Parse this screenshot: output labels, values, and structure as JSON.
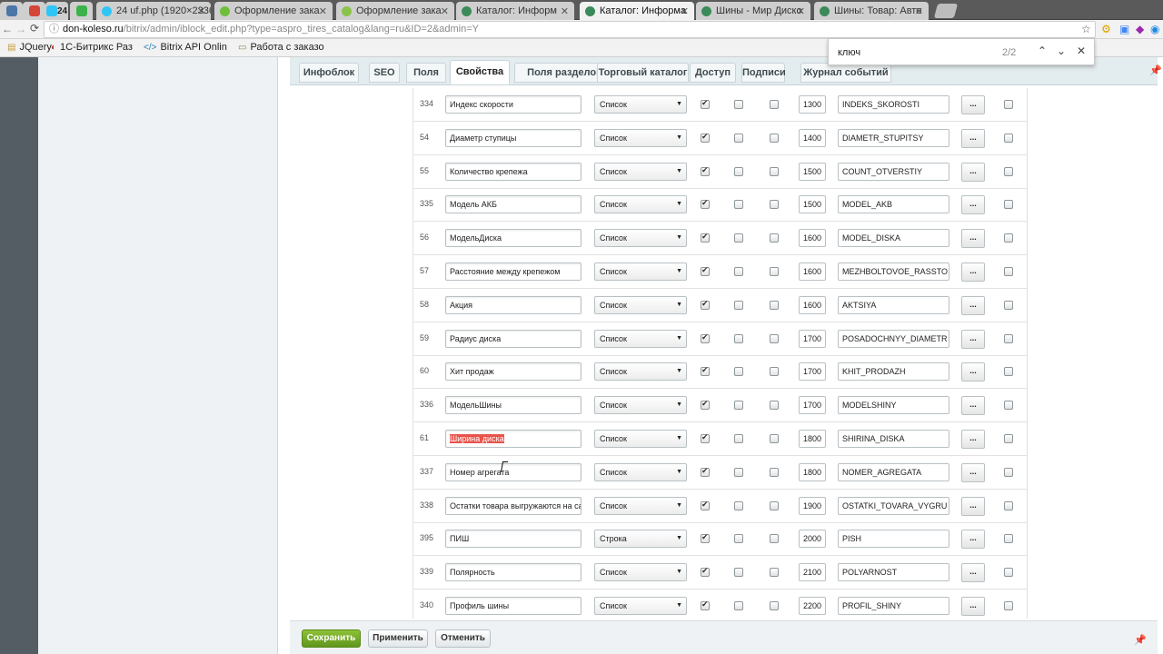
{
  "browser": {
    "tabs": [
      {
        "label": "",
        "fav_color": "#4a76a8"
      },
      {
        "label": "",
        "fav_color": "#d44638"
      },
      {
        "label": "24",
        "fav_color": "#2fc6f6"
      },
      {
        "label": "",
        "fav_color": "#3bb34a"
      },
      {
        "label": "24 uf.php (1920×2336)",
        "fav_color": "#2fc6f6"
      },
      {
        "label": "Оформление зака",
        "fav_color": "#6fbf3a"
      },
      {
        "label": "Оформление зака",
        "fav_color": "#8bc34a"
      },
      {
        "label": "Каталог: Информ",
        "fav_color": "#3b8a5a"
      },
      {
        "label": "Каталог: Информа",
        "fav_color": "#3b8a5a"
      },
      {
        "label": "Шины - Мир Диско",
        "fav_color": "#3b8a5a"
      },
      {
        "label": "Шины: Товар: Авто",
        "fav_color": "#3b8a5a"
      }
    ],
    "url_domain": "don-koleso.ru",
    "url_path": "/bitrix/admin/iblock_edit.php?type=aspro_tires_catalog&lang=ru&ID=2&admin=Y",
    "bookmarks": [
      "JQuery",
      "1С-Битрикс Раз",
      "Bitrix API Onlin",
      "Работа с заказо"
    ],
    "find": {
      "query": "ключ",
      "count": "2/2"
    }
  },
  "editor": {
    "tabs": [
      "Инфоблок",
      "SEO",
      "Поля",
      "Свойства",
      "Поля разделов",
      "Торговый каталог",
      "Доступ",
      "Подписи",
      "Журнал событий"
    ],
    "active_tab": "Свойства",
    "rows": [
      {
        "id": "334",
        "name": "Индекс скорости",
        "type": "Список",
        "sort": "1300",
        "code": "INDEKS_SKOROSTI",
        "more": "..."
      },
      {
        "id": "54",
        "name": "Диаметр ступицы",
        "type": "Список",
        "sort": "1400",
        "code": "DIAMETR_STUPITSY",
        "more": "..."
      },
      {
        "id": "55",
        "name": "Количество крепежа",
        "type": "Список",
        "sort": "1500",
        "code": "COUNT_OTVERSTIY",
        "more": "..."
      },
      {
        "id": "335",
        "name": "Модель АКБ",
        "type": "Список",
        "sort": "1500",
        "code": "MODEL_AKB",
        "more": "..."
      },
      {
        "id": "56",
        "name": "МодельДиска",
        "type": "Список",
        "sort": "1600",
        "code": "MODEL_DISKA",
        "more": "..."
      },
      {
        "id": "57",
        "name": "Расстояние между крепежом",
        "type": "Список",
        "sort": "1600",
        "code": "MEZHBOLTOVOE_RASSTO",
        "more": "..."
      },
      {
        "id": "58",
        "name": "Акция",
        "type": "Список",
        "sort": "1600",
        "code": "AKTSIYA",
        "more": "..."
      },
      {
        "id": "59",
        "name": "Радиус диска",
        "type": "Список",
        "sort": "1700",
        "code": "POSADOCHNYY_DIAMETR",
        "more": "..."
      },
      {
        "id": "60",
        "name": "Хит продаж",
        "type": "Список",
        "sort": "1700",
        "code": "KHIT_PRODAZH",
        "more": "..."
      },
      {
        "id": "336",
        "name": "МодельШины",
        "type": "Список",
        "sort": "1700",
        "code": "MODELSHINY",
        "more": "..."
      },
      {
        "id": "61",
        "name": "Ширина диска",
        "type": "Список",
        "sort": "1800",
        "code": "SHIRINA_DISKA",
        "more": "...",
        "highlight": true
      },
      {
        "id": "337",
        "name": "Номер агрегата",
        "type": "Список",
        "sort": "1800",
        "code": "NOMER_AGREGATA",
        "more": "..."
      },
      {
        "id": "338",
        "name": "Остатки товара выгружаются на са",
        "type": "Список",
        "sort": "1900",
        "code": "OSTATKI_TOVARA_VYGRU",
        "more": "..."
      },
      {
        "id": "395",
        "name": "ПИШ",
        "type": "Строка",
        "sort": "2000",
        "code": "PISH",
        "more": "..."
      },
      {
        "id": "339",
        "name": "Полярность",
        "type": "Список",
        "sort": "2100",
        "code": "POLYARNOST",
        "more": "..."
      },
      {
        "id": "340",
        "name": "Профиль шины",
        "type": "Список",
        "sort": "2200",
        "code": "PROFIL_SHINY",
        "more": "..."
      }
    ],
    "buttons": {
      "save": "Сохранить",
      "apply": "Применить",
      "cancel": "Отменить"
    }
  }
}
